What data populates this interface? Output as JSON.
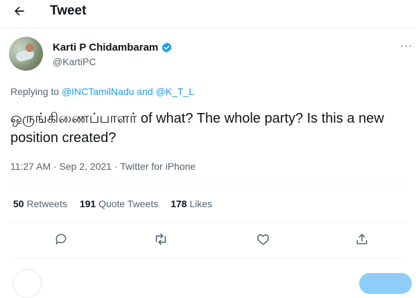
{
  "header": {
    "title": "Tweet"
  },
  "author": {
    "name": "Karti P Chidambaram",
    "handle": "@KartiPC",
    "verified": true
  },
  "replying": {
    "prefix": "Replying to ",
    "mention1": "@INCTamilNadu",
    "conjunction": " and ",
    "mention2": "@K_T_L"
  },
  "tweet": {
    "text": "ஒருங்கிணைப்பாளர் of what? The whole party? Is this a new position created?"
  },
  "meta": {
    "text": "11:27 AM · Sep 2, 2021 · Twitter for iPhone"
  },
  "stats": {
    "retweets_count": "50",
    "retweets_label": "Retweets",
    "quotes_count": "191",
    "quotes_label": "Quote Tweets",
    "likes_count": "178",
    "likes_label": "Likes"
  },
  "colors": {
    "accent": "#1d9bf0",
    "text": "#0f1419",
    "muted": "#536471",
    "divider": "#eff3f4"
  },
  "icons": [
    "back-arrow-icon",
    "verified-badge-icon",
    "more-icon",
    "reply-icon",
    "retweet-icon",
    "like-icon",
    "share-icon"
  ]
}
